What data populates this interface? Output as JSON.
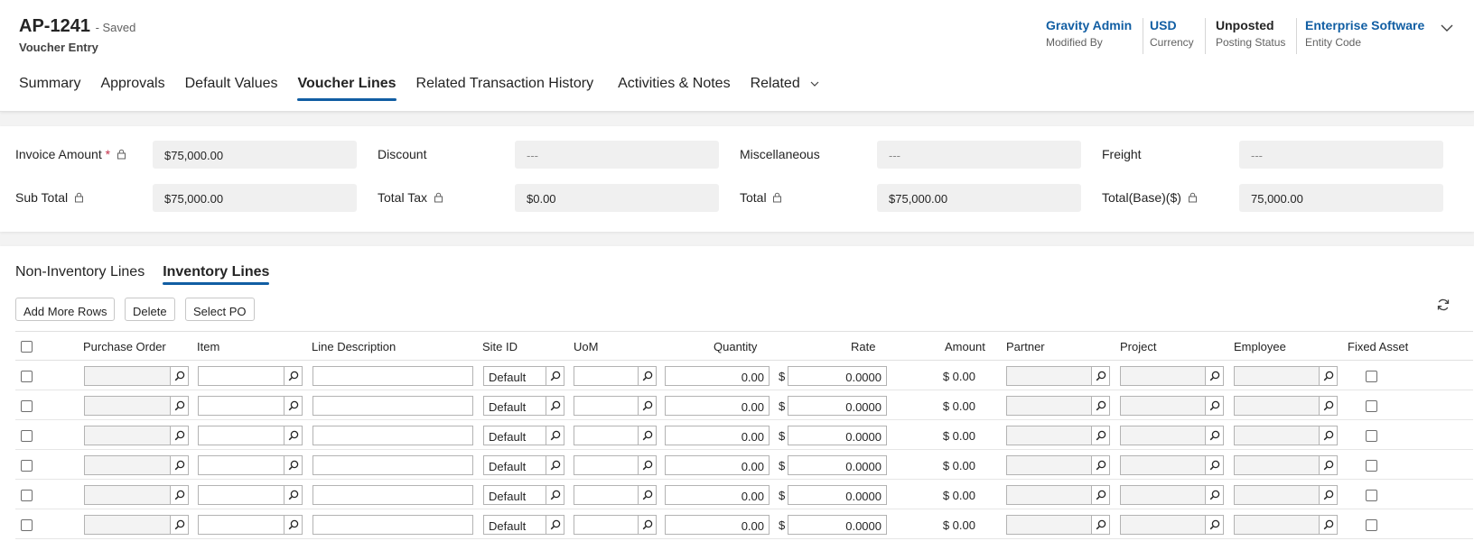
{
  "header": {
    "title": "AP-1241",
    "status": "- Saved",
    "subtitle": "Voucher Entry",
    "meta": [
      {
        "value": "Gravity Admin",
        "label": "Modified By",
        "link": true
      },
      {
        "value": "USD",
        "label": "Currency",
        "link": true
      },
      {
        "value": "Unposted",
        "label": "Posting Status",
        "link": false
      },
      {
        "value": "Enterprise Software",
        "label": "Entity Code",
        "link": true
      }
    ],
    "tabs": [
      "Summary",
      "Approvals",
      "Default Values",
      "Voucher Lines",
      "Related Transaction History",
      "Activities & Notes",
      "Related"
    ],
    "active_tab": "Voucher Lines"
  },
  "totals": {
    "invoice_amount_label": "Invoice Amount",
    "required_mark": "*",
    "invoice_amount": "$75,000.00",
    "discount_label": "Discount",
    "discount": "---",
    "misc_label": "Miscellaneous",
    "misc": "---",
    "freight_label": "Freight",
    "freight": "---",
    "subtotal_label": "Sub Total",
    "subtotal": "$75,000.00",
    "total_tax_label": "Total Tax",
    "total_tax": "$0.00",
    "total_label": "Total",
    "total": "$75,000.00",
    "total_base_label": "Total(Base)($)",
    "total_base": "75,000.00"
  },
  "lines": {
    "subtabs": [
      "Non-Inventory Lines",
      "Inventory Lines"
    ],
    "active_subtab": "Inventory Lines",
    "buttons": {
      "add_more": "Add More Rows",
      "delete": "Delete",
      "select_po": "Select PO"
    },
    "columns": {
      "purchase_order": "Purchase Order",
      "item": "Item",
      "line_description": "Line Description",
      "site_id": "Site ID",
      "uom": "UoM",
      "quantity": "Quantity",
      "rate": "Rate",
      "amount": "Amount",
      "partner": "Partner",
      "project": "Project",
      "employee": "Employee",
      "fixed_asset": "Fixed Asset"
    },
    "rows": [
      {
        "site": "Default",
        "quantity": "0.00",
        "currency": "$",
        "rate": "0.0000",
        "amount": "$ 0.00"
      },
      {
        "site": "Default",
        "quantity": "0.00",
        "currency": "$",
        "rate": "0.0000",
        "amount": "$ 0.00"
      },
      {
        "site": "Default",
        "quantity": "0.00",
        "currency": "$",
        "rate": "0.0000",
        "amount": "$ 0.00"
      },
      {
        "site": "Default",
        "quantity": "0.00",
        "currency": "$",
        "rate": "0.0000",
        "amount": "$ 0.00"
      },
      {
        "site": "Default",
        "quantity": "0.00",
        "currency": "$",
        "rate": "0.0000",
        "amount": "$ 0.00"
      },
      {
        "site": "Default",
        "quantity": "0.00",
        "currency": "$",
        "rate": "0.0000",
        "amount": "$ 0.00"
      }
    ]
  },
  "colors": {
    "accent": "#115ea3",
    "required": "#c4314b"
  }
}
